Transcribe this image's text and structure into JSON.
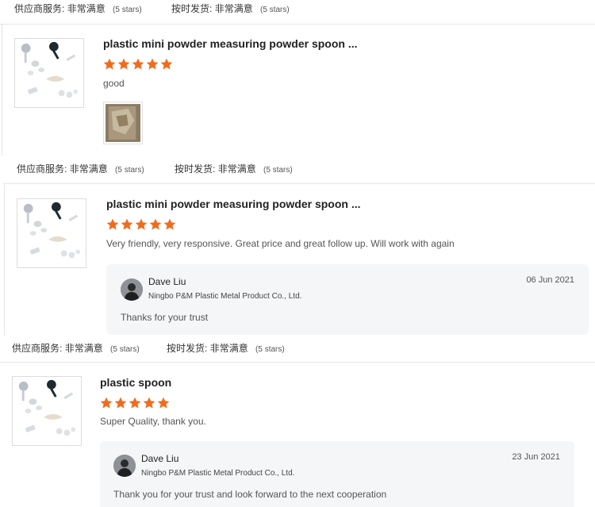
{
  "rating_labels": {
    "supplier_service": "供应商服务:",
    "on_time_shipment": "按时发货:",
    "value": "非常满意",
    "stars_text": "(5 stars)"
  },
  "accent_color": "#f26b1d",
  "reviews": [
    {
      "product_title": "plastic mini powder measuring powder spoon ...",
      "rating": 5,
      "comment": "good",
      "has_photo": true
    },
    {
      "product_title": "plastic mini powder measuring powder spoon ...",
      "rating": 5,
      "comment": "Very friendly, very responsive. Great price and great follow up. Will work with again",
      "reply": {
        "name": "Dave Liu",
        "company": "Ningbo P&M Plastic Metal Product Co., Ltd.",
        "date": "06 Jun 2021",
        "text": "Thanks for your trust"
      }
    },
    {
      "product_title": "plastic spoon",
      "rating": 5,
      "comment": "Super Quality, thank you.",
      "reply": {
        "name": "Dave Liu",
        "company": "Ningbo P&M Plastic Metal Product Co., Ltd.",
        "date": "23 Jun 2021",
        "text": "Thank you for your trust and look forward to the next cooperation"
      }
    }
  ]
}
